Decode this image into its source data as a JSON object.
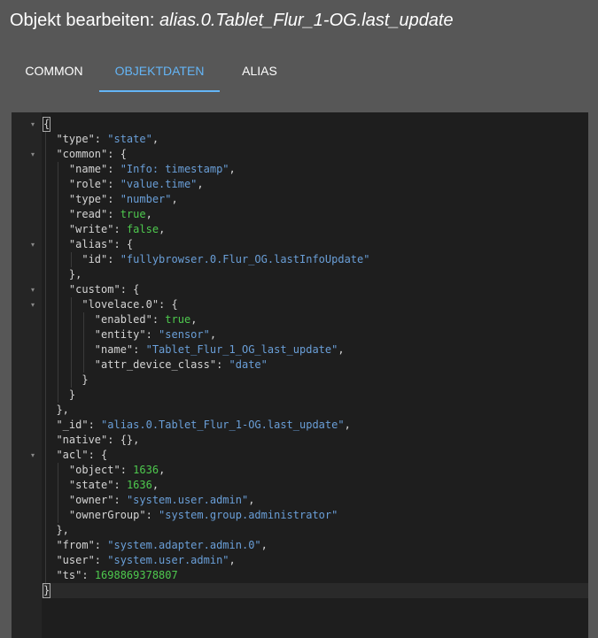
{
  "dialog": {
    "title_prefix": "Objekt bearbeiten: ",
    "title_object": "alias.0.Tablet_Flur_1-OG.last_update"
  },
  "tabs": [
    {
      "label": "COMMON",
      "active": false
    },
    {
      "label": "OBJEKTDATEN",
      "active": true
    },
    {
      "label": "ALIAS",
      "active": false
    }
  ],
  "colors": {
    "accent": "#64b5f6",
    "string": "#6a9fd8",
    "literal": "#4ec94e",
    "background": "#575757",
    "editor_background": "#1e1e1e"
  },
  "editor": {
    "lines": [
      [
        {
          "t": "{",
          "c": "p",
          "cursor": true
        }
      ],
      [
        {
          "t": "  \"type\"",
          "c": "k"
        },
        {
          "t": ": ",
          "c": "p"
        },
        {
          "t": "\"state\"",
          "c": "s"
        },
        {
          "t": ",",
          "c": "p"
        }
      ],
      [
        {
          "t": "  \"common\"",
          "c": "k"
        },
        {
          "t": ": {",
          "c": "p"
        }
      ],
      [
        {
          "t": "    \"name\"",
          "c": "k"
        },
        {
          "t": ": ",
          "c": "p"
        },
        {
          "t": "\"Info: timestamp\"",
          "c": "s"
        },
        {
          "t": ",",
          "c": "p"
        }
      ],
      [
        {
          "t": "    \"role\"",
          "c": "k"
        },
        {
          "t": ": ",
          "c": "p"
        },
        {
          "t": "\"value.time\"",
          "c": "s"
        },
        {
          "t": ",",
          "c": "p"
        }
      ],
      [
        {
          "t": "    \"type\"",
          "c": "k"
        },
        {
          "t": ": ",
          "c": "p"
        },
        {
          "t": "\"number\"",
          "c": "s"
        },
        {
          "t": ",",
          "c": "p"
        }
      ],
      [
        {
          "t": "    \"read\"",
          "c": "k"
        },
        {
          "t": ": ",
          "c": "p"
        },
        {
          "t": "true",
          "c": "b"
        },
        {
          "t": ",",
          "c": "p"
        }
      ],
      [
        {
          "t": "    \"write\"",
          "c": "k"
        },
        {
          "t": ": ",
          "c": "p"
        },
        {
          "t": "false",
          "c": "b"
        },
        {
          "t": ",",
          "c": "p"
        }
      ],
      [
        {
          "t": "    \"alias\"",
          "c": "k"
        },
        {
          "t": ": {",
          "c": "p"
        }
      ],
      [
        {
          "t": "      \"id\"",
          "c": "k"
        },
        {
          "t": ": ",
          "c": "p"
        },
        {
          "t": "\"fullybrowser.0.Flur_OG.lastInfoUpdate\"",
          "c": "s"
        }
      ],
      [
        {
          "t": "    },",
          "c": "p"
        }
      ],
      [
        {
          "t": "    \"custom\"",
          "c": "k"
        },
        {
          "t": ": {",
          "c": "p"
        }
      ],
      [
        {
          "t": "      \"lovelace.0\"",
          "c": "k"
        },
        {
          "t": ": {",
          "c": "p"
        }
      ],
      [
        {
          "t": "        \"enabled\"",
          "c": "k"
        },
        {
          "t": ": ",
          "c": "p"
        },
        {
          "t": "true",
          "c": "b"
        },
        {
          "t": ",",
          "c": "p"
        }
      ],
      [
        {
          "t": "        \"entity\"",
          "c": "k"
        },
        {
          "t": ": ",
          "c": "p"
        },
        {
          "t": "\"sensor\"",
          "c": "s"
        },
        {
          "t": ",",
          "c": "p"
        }
      ],
      [
        {
          "t": "        \"name\"",
          "c": "k"
        },
        {
          "t": ": ",
          "c": "p"
        },
        {
          "t": "\"Tablet_Flur_1_OG_last_update\"",
          "c": "s"
        },
        {
          "t": ",",
          "c": "p"
        }
      ],
      [
        {
          "t": "        \"attr_device_class\"",
          "c": "k"
        },
        {
          "t": ": ",
          "c": "p"
        },
        {
          "t": "\"date\"",
          "c": "s"
        }
      ],
      [
        {
          "t": "      }",
          "c": "p"
        }
      ],
      [
        {
          "t": "    }",
          "c": "p"
        }
      ],
      [
        {
          "t": "  },",
          "c": "p"
        }
      ],
      [
        {
          "t": "  \"_id\"",
          "c": "k"
        },
        {
          "t": ": ",
          "c": "p"
        },
        {
          "t": "\"alias.0.Tablet_Flur_1-OG.last_update\"",
          "c": "s"
        },
        {
          "t": ",",
          "c": "p"
        }
      ],
      [
        {
          "t": "  \"native\"",
          "c": "k"
        },
        {
          "t": ": {},",
          "c": "p"
        }
      ],
      [
        {
          "t": "  \"acl\"",
          "c": "k"
        },
        {
          "t": ": {",
          "c": "p"
        }
      ],
      [
        {
          "t": "    \"object\"",
          "c": "k"
        },
        {
          "t": ": ",
          "c": "p"
        },
        {
          "t": "1636",
          "c": "n"
        },
        {
          "t": ",",
          "c": "p"
        }
      ],
      [
        {
          "t": "    \"state\"",
          "c": "k"
        },
        {
          "t": ": ",
          "c": "p"
        },
        {
          "t": "1636",
          "c": "n"
        },
        {
          "t": ",",
          "c": "p"
        }
      ],
      [
        {
          "t": "    \"owner\"",
          "c": "k"
        },
        {
          "t": ": ",
          "c": "p"
        },
        {
          "t": "\"system.user.admin\"",
          "c": "s"
        },
        {
          "t": ",",
          "c": "p"
        }
      ],
      [
        {
          "t": "    \"ownerGroup\"",
          "c": "k"
        },
        {
          "t": ": ",
          "c": "p"
        },
        {
          "t": "\"system.group.administrator\"",
          "c": "s"
        }
      ],
      [
        {
          "t": "  },",
          "c": "p"
        }
      ],
      [
        {
          "t": "  \"from\"",
          "c": "k"
        },
        {
          "t": ": ",
          "c": "p"
        },
        {
          "t": "\"system.adapter.admin.0\"",
          "c": "s"
        },
        {
          "t": ",",
          "c": "p"
        }
      ],
      [
        {
          "t": "  \"user\"",
          "c": "k"
        },
        {
          "t": ": ",
          "c": "p"
        },
        {
          "t": "\"system.user.admin\"",
          "c": "s"
        },
        {
          "t": ",",
          "c": "p"
        }
      ],
      [
        {
          "t": "  \"ts\"",
          "c": "k"
        },
        {
          "t": ": ",
          "c": "p"
        },
        {
          "t": "1698869378807",
          "c": "n"
        }
      ],
      [
        {
          "t": "}",
          "c": "p",
          "cursor": true
        }
      ]
    ],
    "fold_lines": [
      0,
      2,
      8,
      11,
      12,
      22
    ],
    "active_line": 31
  }
}
